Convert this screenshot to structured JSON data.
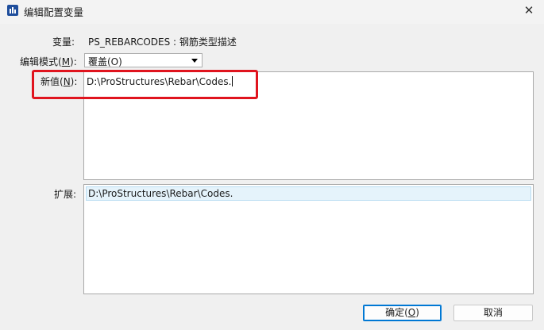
{
  "window": {
    "title": "编辑配置变量",
    "close_glyph": "✕"
  },
  "variable": {
    "label": "变量:",
    "value": "PS_REBARCODES : 钢筋类型描述"
  },
  "edit_mode": {
    "label_pre": "编辑模式(",
    "label_key": "M",
    "label_post": "):",
    "selected": "覆盖(O)"
  },
  "new_value": {
    "label_pre": "新值(",
    "label_key": "N",
    "label_post": "):",
    "value": "D:\\ProStructures\\Rebar\\Codes."
  },
  "expansion": {
    "label": "扩展:",
    "value": "D:\\ProStructures\\Rebar\\Codes."
  },
  "buttons": {
    "ok_pre": "确定(",
    "ok_key": "O",
    "ok_post": ")",
    "cancel": "取消"
  },
  "colors": {
    "highlight": "#e0141e",
    "accent": "#0078d4"
  },
  "icons": {
    "app": "app-icon",
    "close": "close-icon",
    "dropdown": "chevron-down-icon"
  }
}
